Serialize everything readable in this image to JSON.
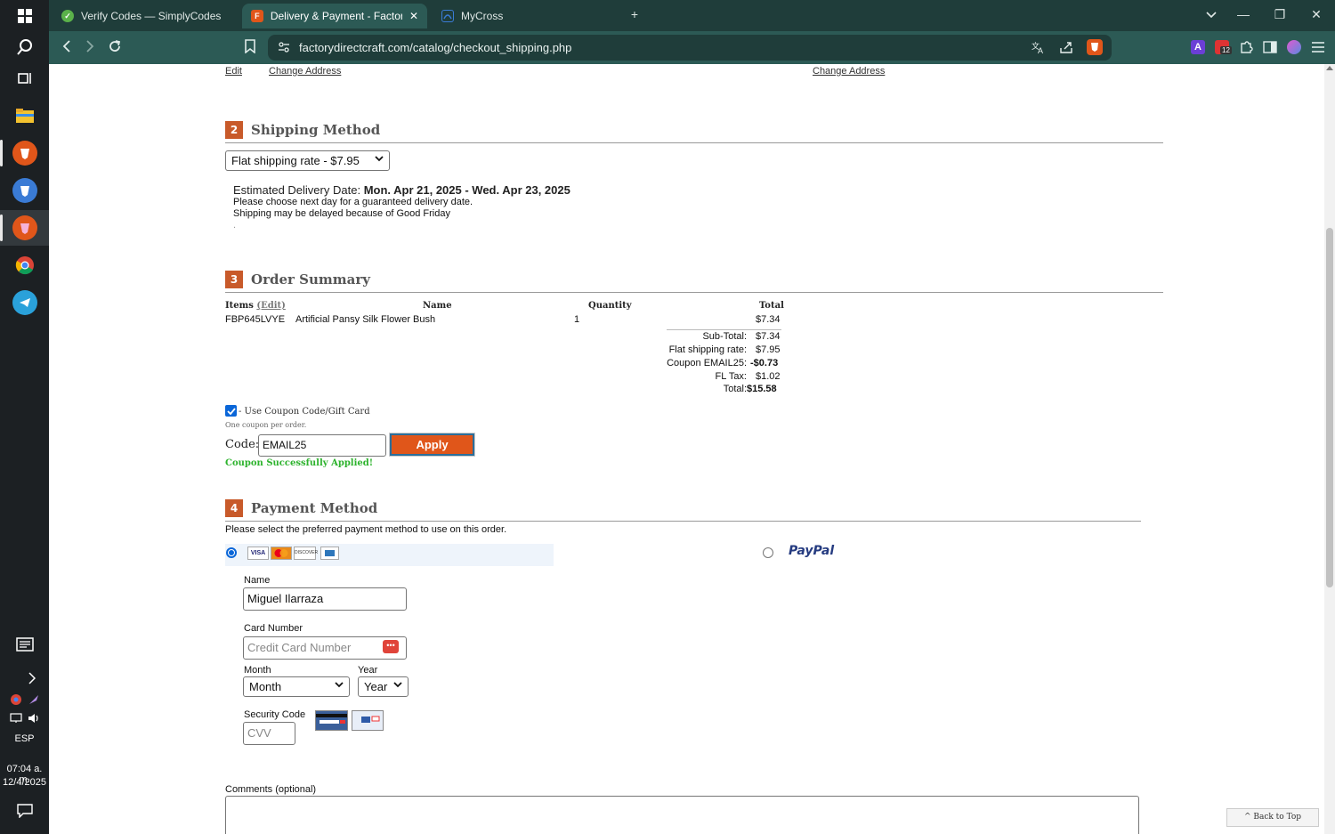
{
  "taskbar": {
    "items": [
      {
        "name": "start-icon"
      },
      {
        "name": "search-icon"
      },
      {
        "name": "task-view-icon"
      },
      {
        "name": "file-explorer-icon"
      },
      {
        "name": "brave-browser-icon"
      },
      {
        "name": "brave-profile-2-icon"
      },
      {
        "name": "brave-profile-3-icon"
      },
      {
        "name": "chrome-icon"
      },
      {
        "name": "telegram-icon"
      }
    ],
    "lang": "ESP",
    "time": "07:04 a. m.",
    "date": "12/4/2025"
  },
  "tabs": [
    {
      "label": "Verify Codes — SimplyCodes",
      "icon": "simplycodes-icon",
      "color": "#5ab24a"
    },
    {
      "label": "Delivery & Payment - Factory D",
      "icon": "factory-direct-icon",
      "color": "#e0561a"
    },
    {
      "label": "MyCross",
      "icon": "mycross-icon",
      "color": "#3a7bd5"
    }
  ],
  "url": "factorydirectcraft.com/catalog/checkout_shipping.php",
  "page": {
    "top_links": {
      "edit": "Edit",
      "change_address_1": "Change Address",
      "change_address_2": "Change Address"
    },
    "shipping": {
      "num": "2",
      "title": "Shipping Method",
      "selected": "Flat shipping rate - $7.95",
      "est_label": "Estimated Delivery Date:",
      "est_dates": "Mon. Apr 21, 2025 - Wed. Apr 23, 2025",
      "note1": "Please choose next day for a guaranteed delivery date.",
      "note2": "Shipping may be delayed because of Good Friday",
      "note3": "."
    },
    "summary": {
      "num": "3",
      "title": "Order Summary",
      "headers": {
        "items": "Items",
        "edit": "(Edit)",
        "name": "Name",
        "quantity": "Quantity",
        "total": "Total"
      },
      "row": {
        "sku": "FBP645LVYE",
        "name": "Artificial Pansy Silk Flower Bush",
        "qty": "1",
        "total": "$7.34"
      },
      "subtotal_label": "Sub-Total:",
      "subtotal": "$7.34",
      "shipping_label": "Flat shipping rate:",
      "shipping": "$7.95",
      "coupon_label": "Coupon EMAIL25:",
      "coupon": "-$0.73",
      "tax_label": "FL Tax:",
      "tax": "$1.02",
      "total_label": "Total:",
      "total": "$15.58"
    },
    "coupon": {
      "checkbox_label": "- Use Coupon Code/Gift Card",
      "note": "One coupon per order.",
      "code_label": "Code:",
      "code_value": "EMAIL25",
      "apply": "Apply",
      "success": "Coupon Successfully Applied!"
    },
    "payment": {
      "num": "4",
      "title": "Payment Method",
      "intro": "Please select the preferred payment method to use on this order.",
      "paypal": "PayPal",
      "name_label": "Name",
      "name_value": "Miguel Ilarraza",
      "card_label": "Card Number",
      "card_placeholder": "Credit Card Number",
      "month_label": "Month",
      "month_value": "Month",
      "year_label": "Year",
      "year_value": "Year",
      "cvv_label": "Security Code",
      "cvv_placeholder": "CVV",
      "comments_label": "Comments (optional)",
      "back_to_top": "^ Back to Top"
    }
  }
}
